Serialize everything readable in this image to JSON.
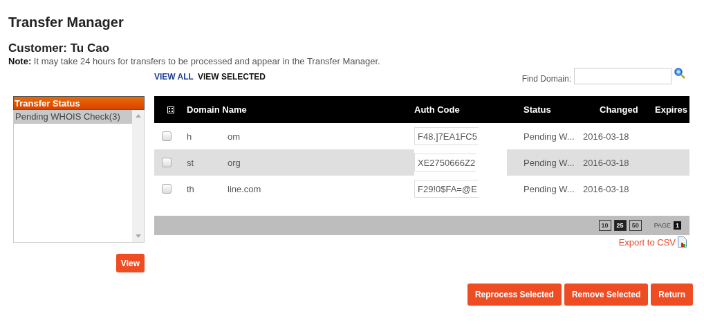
{
  "title": "Transfer Manager",
  "customer": "Customer: Tu Cao",
  "note": "**Note:** It may take 24 hours for transfers to be processed and appear in the Transfer Manager.",
  "view_links": [
    {
      "label": "VIEW ALL",
      "selected": false
    },
    {
      "label": "VIEW SELECTED",
      "selected": true
    }
  ],
  "find": {
    "label": "Find Domain:"
  },
  "status_panel": {
    "title": "Transfer Status",
    "items": [
      {
        "label": "Pending WHOIS Check(3)",
        "selected": true
      }
    ],
    "button": "View"
  },
  "table": {
    "columns": [
      "Domain Name",
      "Auth Code",
      "Status",
      "Changed",
      "Expires"
    ],
    "rows": [
      {
        "checked": false,
        "domain_start": "h",
        "domain_end": "om",
        "auth_code": "F48.]7EA1FC5",
        "status": "Pending W...",
        "changed": "2016-03-18",
        "shaded": false
      },
      {
        "checked": false,
        "domain_start": "st",
        "domain_end": "org",
        "auth_code": "XE2750666Z2",
        "status": "Pending W...",
        "changed": "2016-03-18",
        "shaded": true
      },
      {
        "checked": false,
        "domain_start": "th",
        "domain_end": "line.com",
        "auth_code": "F29!0$FA=@E",
        "status": "Pending W...",
        "changed": "2016-03-18",
        "shaded": false
      }
    ],
    "page_sizes": [
      {
        "label": "10",
        "selected": false
      },
      {
        "label": "25",
        "selected": true
      },
      {
        "label": "50",
        "selected": false
      }
    ],
    "page_label": "PAGE",
    "page": "1"
  },
  "export": "Export to CSV",
  "buttons": [
    "Reprocess Selected",
    "Remove Selected",
    "Return"
  ]
}
